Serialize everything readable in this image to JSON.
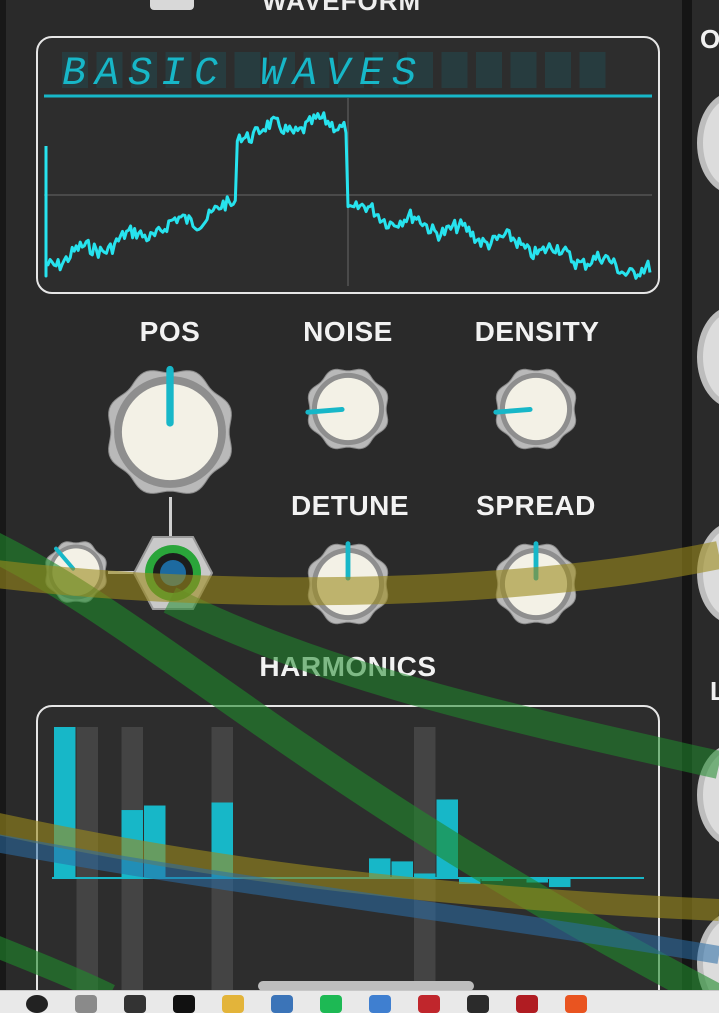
{
  "module": {
    "header_label": "WAVEFORM",
    "display_text": "BASIC WAVES",
    "display_blank_cells": 5
  },
  "knobs": {
    "pos": {
      "label": "POS",
      "value_fraction": 0.5
    },
    "noise": {
      "label": "NOISE",
      "value_fraction": 0.15
    },
    "density": {
      "label": "DENSITY",
      "value_fraction": 0.15
    },
    "detune": {
      "label": "DETUNE",
      "value_fraction": 0.5
    },
    "spread": {
      "label": "SPREAD",
      "value_fraction": 0.5
    },
    "attenuator": {
      "value_fraction": 0.35
    }
  },
  "harmonics": {
    "label": "HARMONICS"
  },
  "right_panel": {
    "letters": [
      "O",
      "L"
    ]
  },
  "colors": {
    "accent": "#17b7c8",
    "panel": "#2a2a2a",
    "text": "#f2f2f2",
    "knob_face": "#f3f1e6",
    "knob_ring": "#b9b9b9",
    "cable_green": "#1f8a2c",
    "cable_yellow": "#9b8a1c",
    "cable_blue": "#2a6ea8"
  },
  "taskbar": {
    "icons": [
      "chrome-icon",
      "cat-icon",
      "github-icon",
      "x-icon",
      "folder-icon",
      "python-icon",
      "spotify-icon",
      "globe-icon",
      "filezilla-icon",
      "terminal-icon",
      "ruby-icon",
      "ubuntu-icon"
    ]
  }
}
